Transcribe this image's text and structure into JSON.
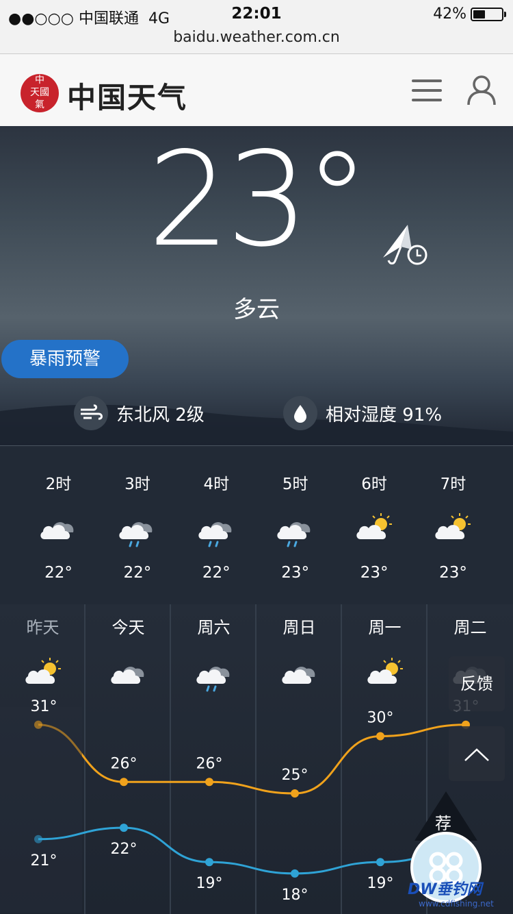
{
  "status_bar": {
    "carrier": "●●○○○ 中国联通",
    "network": "4G",
    "time": "22:01",
    "battery": "42%",
    "battery_fraction": 0.42
  },
  "browser": {
    "url": "baidu.weather.com.cn"
  },
  "header": {
    "seal_top": "中",
    "seal_mid": "天國",
    "seal_bottom": "氣",
    "title": "中国天气",
    "menu_icon": "hamburger-icon",
    "user_icon": "user-icon"
  },
  "current": {
    "temperature": "23°",
    "condition": "多云",
    "alert_button": "暴雨预警",
    "wind": "东北风 2级",
    "humidity": "相对湿度 91%"
  },
  "hourly": [
    {
      "label": "2时",
      "icon": "cloudy-icon",
      "temp": "22°"
    },
    {
      "label": "3时",
      "icon": "rain-icon",
      "temp": "22°"
    },
    {
      "label": "4时",
      "icon": "rain-icon",
      "temp": "22°"
    },
    {
      "label": "5时",
      "icon": "rain-icon",
      "temp": "23°"
    },
    {
      "label": "6时",
      "icon": "partly-sunny-icon",
      "temp": "23°"
    },
    {
      "label": "7时",
      "icon": "partly-sunny-icon",
      "temp": "23°"
    }
  ],
  "daily": [
    {
      "label": "昨天",
      "icon": "partly-sunny-icon"
    },
    {
      "label": "今天",
      "icon": "cloudy-icon"
    },
    {
      "label": "周六",
      "icon": "rain-icon"
    },
    {
      "label": "周日",
      "icon": "cloudy-icon"
    },
    {
      "label": "周一",
      "icon": "partly-sunny-icon"
    },
    {
      "label": "周二",
      "icon": "cloudy-icon"
    }
  ],
  "chart_data": {
    "type": "line",
    "categories": [
      "昨天",
      "今天",
      "周六",
      "周日",
      "周一",
      "周二"
    ],
    "series": [
      {
        "values": [
          31,
          26,
          26,
          25,
          30,
          31
        ],
        "color": "#f0a21c"
      },
      {
        "values": [
          21,
          22,
          19,
          18,
          19,
          20
        ],
        "color": "#2fa3d6"
      }
    ],
    "high_labels": [
      "31°",
      "26°",
      "26°",
      "25°",
      "30°",
      "31°"
    ],
    "low_labels": [
      "21°",
      "22°",
      "19°",
      "18°",
      "19°",
      ""
    ]
  },
  "side_buttons": {
    "feedback": "反馈",
    "to_top_icon": "chevron-up-icon",
    "recommend": "荐"
  },
  "watermark": {
    "brand": "DW垂钓网",
    "url": "www.cdfishing.net"
  }
}
